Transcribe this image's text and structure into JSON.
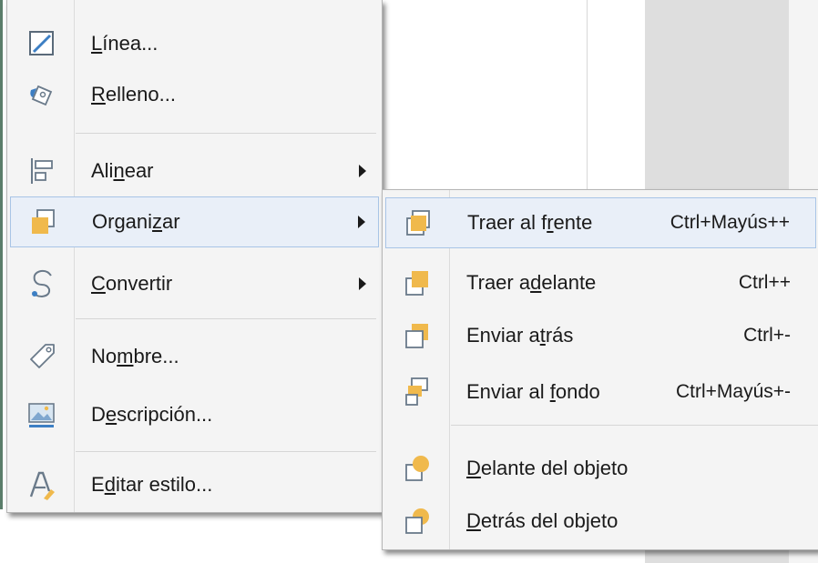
{
  "main_menu": {
    "items": [
      {
        "pre": "",
        "u": "L",
        "post": "ínea..."
      },
      {
        "pre": "",
        "u": "R",
        "post": "elleno..."
      },
      {
        "pre": "Ali",
        "u": "n",
        "post": "ear"
      },
      {
        "pre": "Organi",
        "u": "z",
        "post": "ar"
      },
      {
        "pre": "",
        "u": "C",
        "post": "onvertir"
      },
      {
        "pre": "No",
        "u": "m",
        "post": "bre..."
      },
      {
        "pre": "D",
        "u": "e",
        "post": "scripción..."
      },
      {
        "pre": "E",
        "u": "d",
        "post": "itar estilo..."
      }
    ]
  },
  "sub_menu": {
    "items": [
      {
        "pre": "Traer al f",
        "u": "r",
        "post": "ente",
        "shortcut": "Ctrl+Mayús++"
      },
      {
        "pre": "Traer a",
        "u": "d",
        "post": "elante",
        "shortcut": "Ctrl++"
      },
      {
        "pre": "Enviar a",
        "u": "t",
        "post": "rás",
        "shortcut": "Ctrl+-"
      },
      {
        "pre": "Enviar al ",
        "u": "f",
        "post": "ondo",
        "shortcut": "Ctrl+Mayús+-"
      },
      {
        "pre": "",
        "u": "D",
        "post": "elante del objeto",
        "shortcut": ""
      },
      {
        "pre": "",
        "u": "D",
        "post": "etrás del objeto",
        "shortcut": ""
      }
    ]
  },
  "colors": {
    "accent_orange": "#f0b94c",
    "hover_bg": "#e9eff8",
    "hover_border": "#a8c4e6"
  }
}
